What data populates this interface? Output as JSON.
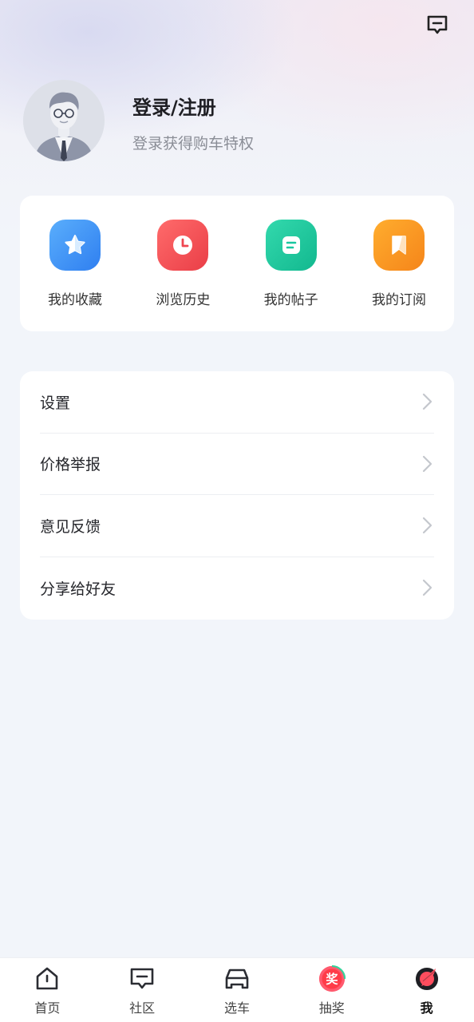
{
  "header": {
    "message_icon": "message-icon"
  },
  "profile": {
    "title": "登录/注册",
    "subtitle": "登录获得购车特权"
  },
  "quick_actions": [
    {
      "label": "我的收藏",
      "icon": "star-icon",
      "color": "#3a8df5"
    },
    {
      "label": "浏览历史",
      "icon": "clock-icon",
      "color": "#f14d4d"
    },
    {
      "label": "我的帖子",
      "icon": "post-icon",
      "color": "#19c7a0"
    },
    {
      "label": "我的订阅",
      "icon": "bookmark-icon",
      "color": "#f7931e"
    }
  ],
  "menu": [
    {
      "label": "设置"
    },
    {
      "label": "价格举报"
    },
    {
      "label": "意见反馈"
    },
    {
      "label": "分享给好友"
    }
  ],
  "tabbar": [
    {
      "label": "首页",
      "icon": "home-icon"
    },
    {
      "label": "社区",
      "icon": "community-icon"
    },
    {
      "label": "选车",
      "icon": "car-icon"
    },
    {
      "label": "抽奖",
      "icon": "lottery-icon",
      "badge_text": "奖"
    },
    {
      "label": "我",
      "icon": "me-icon",
      "active": true
    }
  ]
}
